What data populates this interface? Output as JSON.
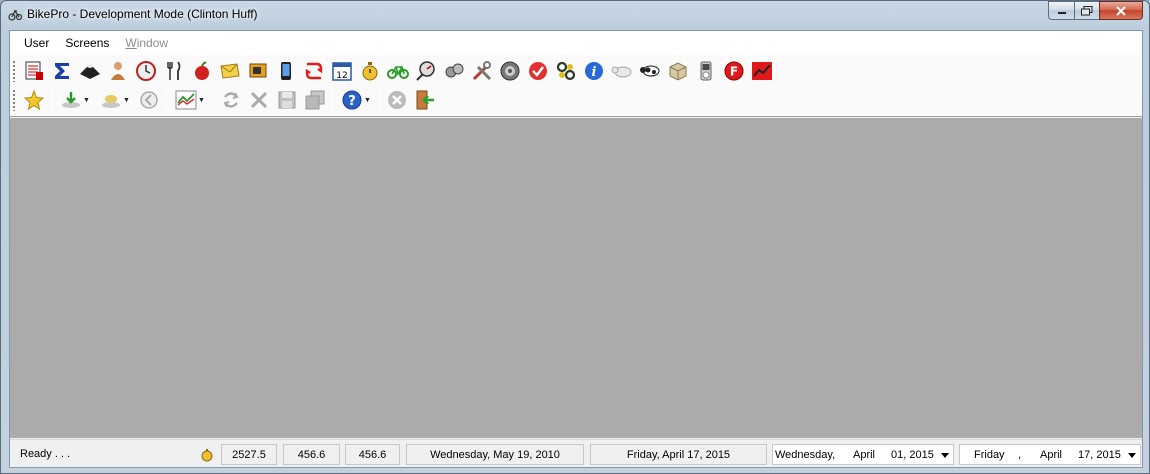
{
  "window": {
    "title": "BikePro - Development Mode (Clinton Huff)"
  },
  "menu": [
    {
      "label": "User",
      "enabled": true
    },
    {
      "label": "Screens",
      "enabled": true
    },
    {
      "label": "Window",
      "enabled": false
    }
  ],
  "toolbar_top": {
    "icons": [
      "spreadsheet-icon",
      "sigma-icon",
      "mountain-icon",
      "person-icon",
      "clock-icon",
      "fork-knife-icon",
      "apple-icon",
      "envelope-icon",
      "display-icon",
      "phone-icon",
      "refresh-red-icon",
      "calendar-icon",
      "stopwatch-icon",
      "bicycle-icon",
      "gauge-icon",
      "bike-parts-icon",
      "tools-icon",
      "gear-icon",
      "checkmark-icon",
      "chain-icon",
      "info-icon",
      "bear-icon",
      "cow-icon",
      "box-icon",
      "ipod-icon",
      "letter-f-icon",
      "stock-chart-icon"
    ],
    "calendar_day": "12"
  },
  "toolbar_bottom": {
    "icons": [
      "star-icon",
      "download-icon",
      "cloud-icon",
      "back-icon",
      "chart-dropdown-icon",
      "refresh-icon",
      "delete-icon",
      "save-icon",
      "copy-icon",
      "help-icon",
      "cancel-icon",
      "exit-icon"
    ]
  },
  "status": {
    "text": "Ready . . .",
    "value1": "2527.5",
    "value2": "456.6",
    "value3": "456.6",
    "date1": "Wednesday, May 19, 2010",
    "date2": "Friday, April 17, 2015",
    "combo1": {
      "day": "Wednesday,",
      "month": "April",
      "date": "01, 2015"
    },
    "combo2": {
      "day": "Friday",
      "sep": ",",
      "month": "April",
      "date": "17, 2015"
    }
  },
  "colors": {
    "mdi_background": "#ababab",
    "accent_close": "#c2432b"
  }
}
